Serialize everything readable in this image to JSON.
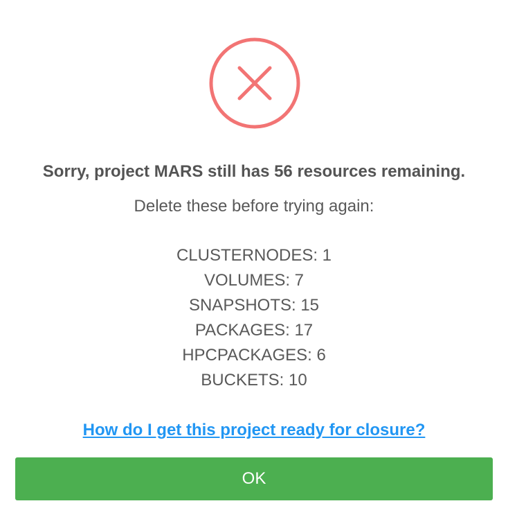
{
  "dialog": {
    "icon": "error-x-circle-icon",
    "title": "Sorry, project MARS still has 56 resources remaining.",
    "subtitle": "Delete these before trying again:",
    "resources": [
      {
        "text": "CLUSTERNODES: 1"
      },
      {
        "text": "VOLUMES: 7"
      },
      {
        "text": "SNAPSHOTS: 15"
      },
      {
        "text": "PACKAGES: 17"
      },
      {
        "text": "HPCPACKAGES: 6"
      },
      {
        "text": "BUCKETS: 10"
      }
    ],
    "help_link": "How do I get this project ready for closure?",
    "ok_label": "OK"
  },
  "colors": {
    "error_icon": "#f27474",
    "link": "#2196f3",
    "ok_button": "#4caf50",
    "text": "#595959"
  }
}
